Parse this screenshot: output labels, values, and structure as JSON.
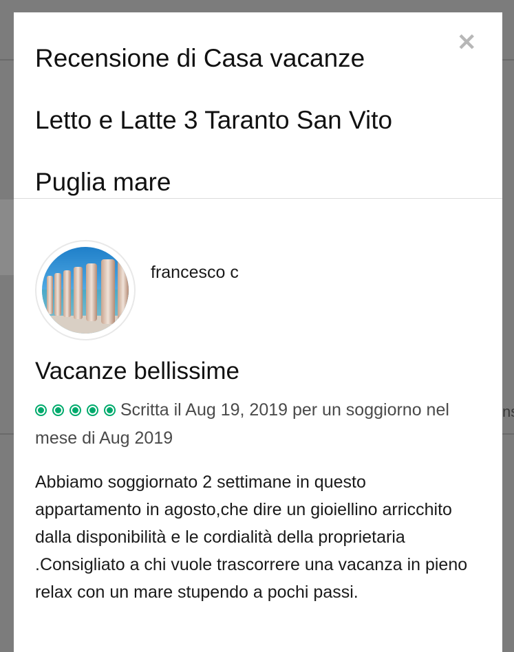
{
  "modal": {
    "title_lines": [
      "Recensione di Casa vacanze",
      "Letto e Latte 3 Taranto San Vito",
      "Puglia mare"
    ],
    "close_icon": "close-icon"
  },
  "review": {
    "reviewer_name": "francesco c",
    "avatar": "beach-pillars-photo",
    "title": "Vacanze bellissime",
    "rating": 5,
    "rating_max": 5,
    "rating_color": "#00aa6c",
    "meta": "Scritta il Aug 19, 2019 per un soggiorno nel mese di Aug 2019",
    "text": "Abbiamo soggiornato 2 settimane in questo appartamento in agosto,che dire un gioiellino arricchito dalla disponibilità e le cordialità della proprietaria .Consigliato a chi vuole trascorrere una vacanza in pieno relax con un mare stupendo a pochi passi."
  },
  "background": {
    "partial_text": "ns"
  }
}
